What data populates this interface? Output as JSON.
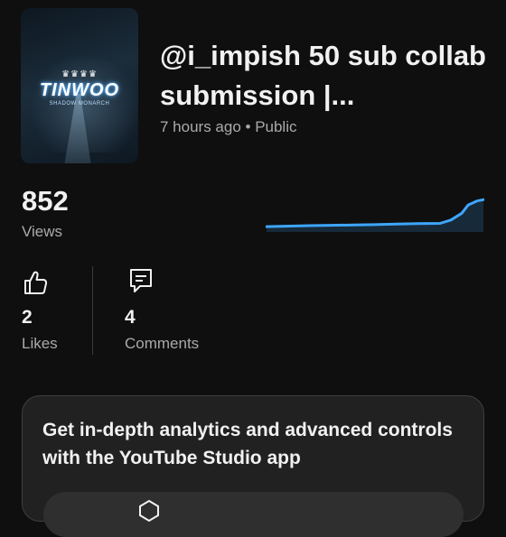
{
  "video": {
    "title": "@i_impish 50 sub collab submission |...",
    "meta": "7 hours ago • Public",
    "thumbnail": {
      "logo_text": "TINWOO",
      "subtitle_text": "SHADOW MONARCH"
    }
  },
  "stats": {
    "views": {
      "value": "852",
      "label": "Views"
    },
    "likes": {
      "value": "2",
      "label": "Likes",
      "icon": "thumbs-up-icon"
    },
    "comments": {
      "value": "4",
      "label": "Comments",
      "icon": "comment-icon"
    }
  },
  "chart_data": {
    "type": "line",
    "title": "",
    "xlabel": "",
    "ylabel": "",
    "x": [
      0,
      0.2,
      0.4,
      0.5,
      0.6,
      0.7,
      0.8,
      0.85,
      0.9,
      0.93,
      0.97,
      1.0
    ],
    "series": [
      {
        "values": [
          0.05,
          0.08,
          0.1,
          0.11,
          0.13,
          0.14,
          0.15,
          0.25,
          0.45,
          0.7,
          0.82,
          0.86
        ]
      }
    ],
    "color": "#3ea6ff",
    "grid": false
  },
  "promo": {
    "text": "Get in-depth analytics and advanced controls with the YouTube Studio app"
  },
  "colors": {
    "background": "#0f0f0f",
    "accent": "#3ea6ff",
    "secondary_text": "#aaaaaa"
  }
}
